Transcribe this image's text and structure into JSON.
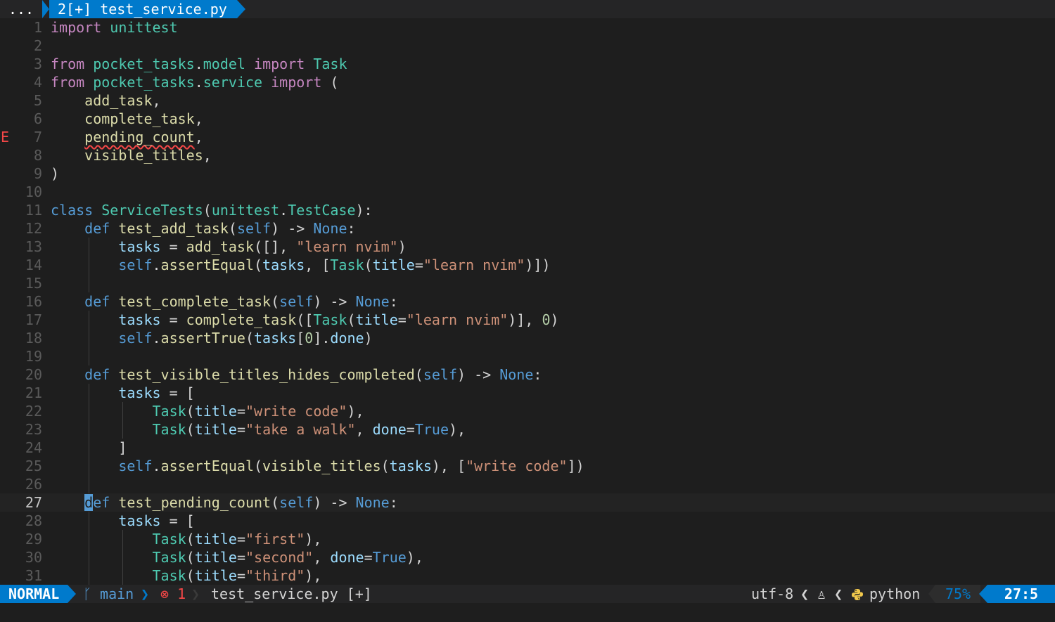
{
  "tabline": {
    "ellipsis": "...",
    "active_tab": "2[+] test_service.py"
  },
  "editor": {
    "cursor_line": 27,
    "error_sign": "E",
    "lines": [
      {
        "n": "1"
      },
      {
        "n": "2"
      },
      {
        "n": "3"
      },
      {
        "n": "4"
      },
      {
        "n": "5"
      },
      {
        "n": "6"
      },
      {
        "n": "7"
      },
      {
        "n": "8"
      },
      {
        "n": "9"
      },
      {
        "n": "10"
      },
      {
        "n": "11"
      },
      {
        "n": "12"
      },
      {
        "n": "13"
      },
      {
        "n": "14"
      },
      {
        "n": "15"
      },
      {
        "n": "16"
      },
      {
        "n": "17"
      },
      {
        "n": "18"
      },
      {
        "n": "19"
      },
      {
        "n": "20"
      },
      {
        "n": "21"
      },
      {
        "n": "22"
      },
      {
        "n": "23"
      },
      {
        "n": "24"
      },
      {
        "n": "25"
      },
      {
        "n": "26"
      },
      {
        "n": "27"
      },
      {
        "n": "28"
      },
      {
        "n": "29"
      },
      {
        "n": "30"
      },
      {
        "n": "31"
      }
    ],
    "code": {
      "l1": [
        [
          "kw",
          "import"
        ],
        [
          "op",
          " "
        ],
        [
          "mod",
          "unittest"
        ]
      ],
      "l2": [],
      "l3": [
        [
          "kw",
          "from"
        ],
        [
          "op",
          " "
        ],
        [
          "mod",
          "pocket_tasks"
        ],
        [
          "op",
          "."
        ],
        [
          "mod",
          "model"
        ],
        [
          "op",
          " "
        ],
        [
          "kw",
          "import"
        ],
        [
          "op",
          " "
        ],
        [
          "cls",
          "Task"
        ]
      ],
      "l4": [
        [
          "kw",
          "from"
        ],
        [
          "op",
          " "
        ],
        [
          "mod",
          "pocket_tasks"
        ],
        [
          "op",
          "."
        ],
        [
          "mod",
          "service"
        ],
        [
          "op",
          " "
        ],
        [
          "kw",
          "import"
        ],
        [
          "op",
          " ("
        ]
      ],
      "l5": [
        [
          "op",
          "    "
        ],
        [
          "fn",
          "add_task"
        ],
        [
          "op",
          ","
        ]
      ],
      "l6": [
        [
          "op",
          "    "
        ],
        [
          "fn",
          "complete_task"
        ],
        [
          "op",
          ","
        ]
      ],
      "l7": [
        [
          "op",
          "    "
        ],
        [
          "fn err",
          "pending_count"
        ],
        [
          "op",
          ","
        ]
      ],
      "l8": [
        [
          "op",
          "    "
        ],
        [
          "fn",
          "visible_titles"
        ],
        [
          "op",
          ","
        ]
      ],
      "l9": [
        [
          "op",
          ")"
        ]
      ],
      "l10": [],
      "l11": [
        [
          "def",
          "class"
        ],
        [
          "op",
          " "
        ],
        [
          "cls",
          "ServiceTests"
        ],
        [
          "op",
          "("
        ],
        [
          "mod",
          "unittest"
        ],
        [
          "op",
          "."
        ],
        [
          "cls",
          "TestCase"
        ],
        [
          "op",
          "):"
        ]
      ],
      "l12": [
        [
          "op",
          "    "
        ],
        [
          "def",
          "def"
        ],
        [
          "op",
          " "
        ],
        [
          "fn",
          "test_add_task"
        ],
        [
          "op",
          "("
        ],
        [
          "self",
          "self"
        ],
        [
          "op",
          ") -> "
        ],
        [
          "con",
          "None"
        ],
        [
          "op",
          ":"
        ]
      ],
      "l13": [
        [
          "op",
          "        "
        ],
        [
          "var",
          "tasks"
        ],
        [
          "op",
          " = "
        ],
        [
          "fn",
          "add_task"
        ],
        [
          "op",
          "([], "
        ],
        [
          "str",
          "\"learn nvim\""
        ],
        [
          "op",
          ")"
        ]
      ],
      "l14": [
        [
          "op",
          "        "
        ],
        [
          "self",
          "self"
        ],
        [
          "op",
          "."
        ],
        [
          "fn",
          "assertEqual"
        ],
        [
          "op",
          "("
        ],
        [
          "var",
          "tasks"
        ],
        [
          "op",
          ", ["
        ],
        [
          "cls",
          "Task"
        ],
        [
          "op",
          "("
        ],
        [
          "var",
          "title"
        ],
        [
          "op",
          "="
        ],
        [
          "str",
          "\"learn nvim\""
        ],
        [
          "op",
          ")])"
        ]
      ],
      "l15": [],
      "l16": [
        [
          "op",
          "    "
        ],
        [
          "def",
          "def"
        ],
        [
          "op",
          " "
        ],
        [
          "fn",
          "test_complete_task"
        ],
        [
          "op",
          "("
        ],
        [
          "self",
          "self"
        ],
        [
          "op",
          ") -> "
        ],
        [
          "con",
          "None"
        ],
        [
          "op",
          ":"
        ]
      ],
      "l17": [
        [
          "op",
          "        "
        ],
        [
          "var",
          "tasks"
        ],
        [
          "op",
          " = "
        ],
        [
          "fn",
          "complete_task"
        ],
        [
          "op",
          "(["
        ],
        [
          "cls",
          "Task"
        ],
        [
          "op",
          "("
        ],
        [
          "var",
          "title"
        ],
        [
          "op",
          "="
        ],
        [
          "str",
          "\"learn nvim\""
        ],
        [
          "op",
          ")], "
        ],
        [
          "num",
          "0"
        ],
        [
          "op",
          ")"
        ]
      ],
      "l18": [
        [
          "op",
          "        "
        ],
        [
          "self",
          "self"
        ],
        [
          "op",
          "."
        ],
        [
          "fn",
          "assertTrue"
        ],
        [
          "op",
          "("
        ],
        [
          "var",
          "tasks"
        ],
        [
          "op",
          "["
        ],
        [
          "num",
          "0"
        ],
        [
          "op",
          "]."
        ],
        [
          "var",
          "done"
        ],
        [
          "op",
          ")"
        ]
      ],
      "l19": [],
      "l20": [
        [
          "op",
          "    "
        ],
        [
          "def",
          "def"
        ],
        [
          "op",
          " "
        ],
        [
          "fn",
          "test_visible_titles_hides_completed"
        ],
        [
          "op",
          "("
        ],
        [
          "self",
          "self"
        ],
        [
          "op",
          ") -> "
        ],
        [
          "con",
          "None"
        ],
        [
          "op",
          ":"
        ]
      ],
      "l21": [
        [
          "op",
          "        "
        ],
        [
          "var",
          "tasks"
        ],
        [
          "op",
          " = ["
        ]
      ],
      "l22": [
        [
          "op",
          "            "
        ],
        [
          "cls",
          "Task"
        ],
        [
          "op",
          "("
        ],
        [
          "var",
          "title"
        ],
        [
          "op",
          "="
        ],
        [
          "str",
          "\"write code\""
        ],
        [
          "op",
          "),"
        ]
      ],
      "l23": [
        [
          "op",
          "            "
        ],
        [
          "cls",
          "Task"
        ],
        [
          "op",
          "("
        ],
        [
          "var",
          "title"
        ],
        [
          "op",
          "="
        ],
        [
          "str",
          "\"take a walk\""
        ],
        [
          "op",
          ", "
        ],
        [
          "var",
          "done"
        ],
        [
          "op",
          "="
        ],
        [
          "con",
          "True"
        ],
        [
          "op",
          "),"
        ]
      ],
      "l24": [
        [
          "op",
          "        ]"
        ]
      ],
      "l25": [
        [
          "op",
          "        "
        ],
        [
          "self",
          "self"
        ],
        [
          "op",
          "."
        ],
        [
          "fn",
          "assertEqual"
        ],
        [
          "op",
          "("
        ],
        [
          "fn",
          "visible_titles"
        ],
        [
          "op",
          "("
        ],
        [
          "var",
          "tasks"
        ],
        [
          "op",
          "), ["
        ],
        [
          "str",
          "\"write code\""
        ],
        [
          "op",
          "])"
        ]
      ],
      "l26": [],
      "l27": [
        [
          "op",
          "    "
        ],
        [
          "cur",
          "d"
        ],
        [
          "def",
          "ef"
        ],
        [
          "op",
          " "
        ],
        [
          "fn",
          "test_pending_count"
        ],
        [
          "op",
          "("
        ],
        [
          "self",
          "self"
        ],
        [
          "op",
          ") -> "
        ],
        [
          "con",
          "None"
        ],
        [
          "op",
          ":"
        ]
      ],
      "l28": [
        [
          "op",
          "        "
        ],
        [
          "var",
          "tasks"
        ],
        [
          "op",
          " = ["
        ]
      ],
      "l29": [
        [
          "op",
          "            "
        ],
        [
          "cls",
          "Task"
        ],
        [
          "op",
          "("
        ],
        [
          "var",
          "title"
        ],
        [
          "op",
          "="
        ],
        [
          "str",
          "\"first\""
        ],
        [
          "op",
          "),"
        ]
      ],
      "l30": [
        [
          "op",
          "            "
        ],
        [
          "cls",
          "Task"
        ],
        [
          "op",
          "("
        ],
        [
          "var",
          "title"
        ],
        [
          "op",
          "="
        ],
        [
          "str",
          "\"second\""
        ],
        [
          "op",
          ", "
        ],
        [
          "var",
          "done"
        ],
        [
          "op",
          "="
        ],
        [
          "con",
          "True"
        ],
        [
          "op",
          "),"
        ]
      ],
      "l31": [
        [
          "op",
          "            "
        ],
        [
          "cls",
          "Task"
        ],
        [
          "op",
          "("
        ],
        [
          "var",
          "title"
        ],
        [
          "op",
          "="
        ],
        [
          "str",
          "\"third\""
        ],
        [
          "op",
          "),"
        ]
      ]
    }
  },
  "statusline": {
    "mode": "NORMAL",
    "branch_icon": "ᚴ",
    "branch": "main",
    "sep_right": "❯",
    "diag_icon": "⊗",
    "diag_count": "1",
    "sep_right_dim": "❯",
    "file": "test_service.py [+]",
    "encoding": "utf-8",
    "sep_left": "❮",
    "os_icon": "linux-tux-icon",
    "os_glyph": "♙",
    "lang_icon": "python-icon",
    "language": "python",
    "percent": "75%",
    "position": "27:5"
  },
  "colors": {
    "accent": "#007acc",
    "background": "#1e1e1e",
    "error": "#f44747"
  }
}
